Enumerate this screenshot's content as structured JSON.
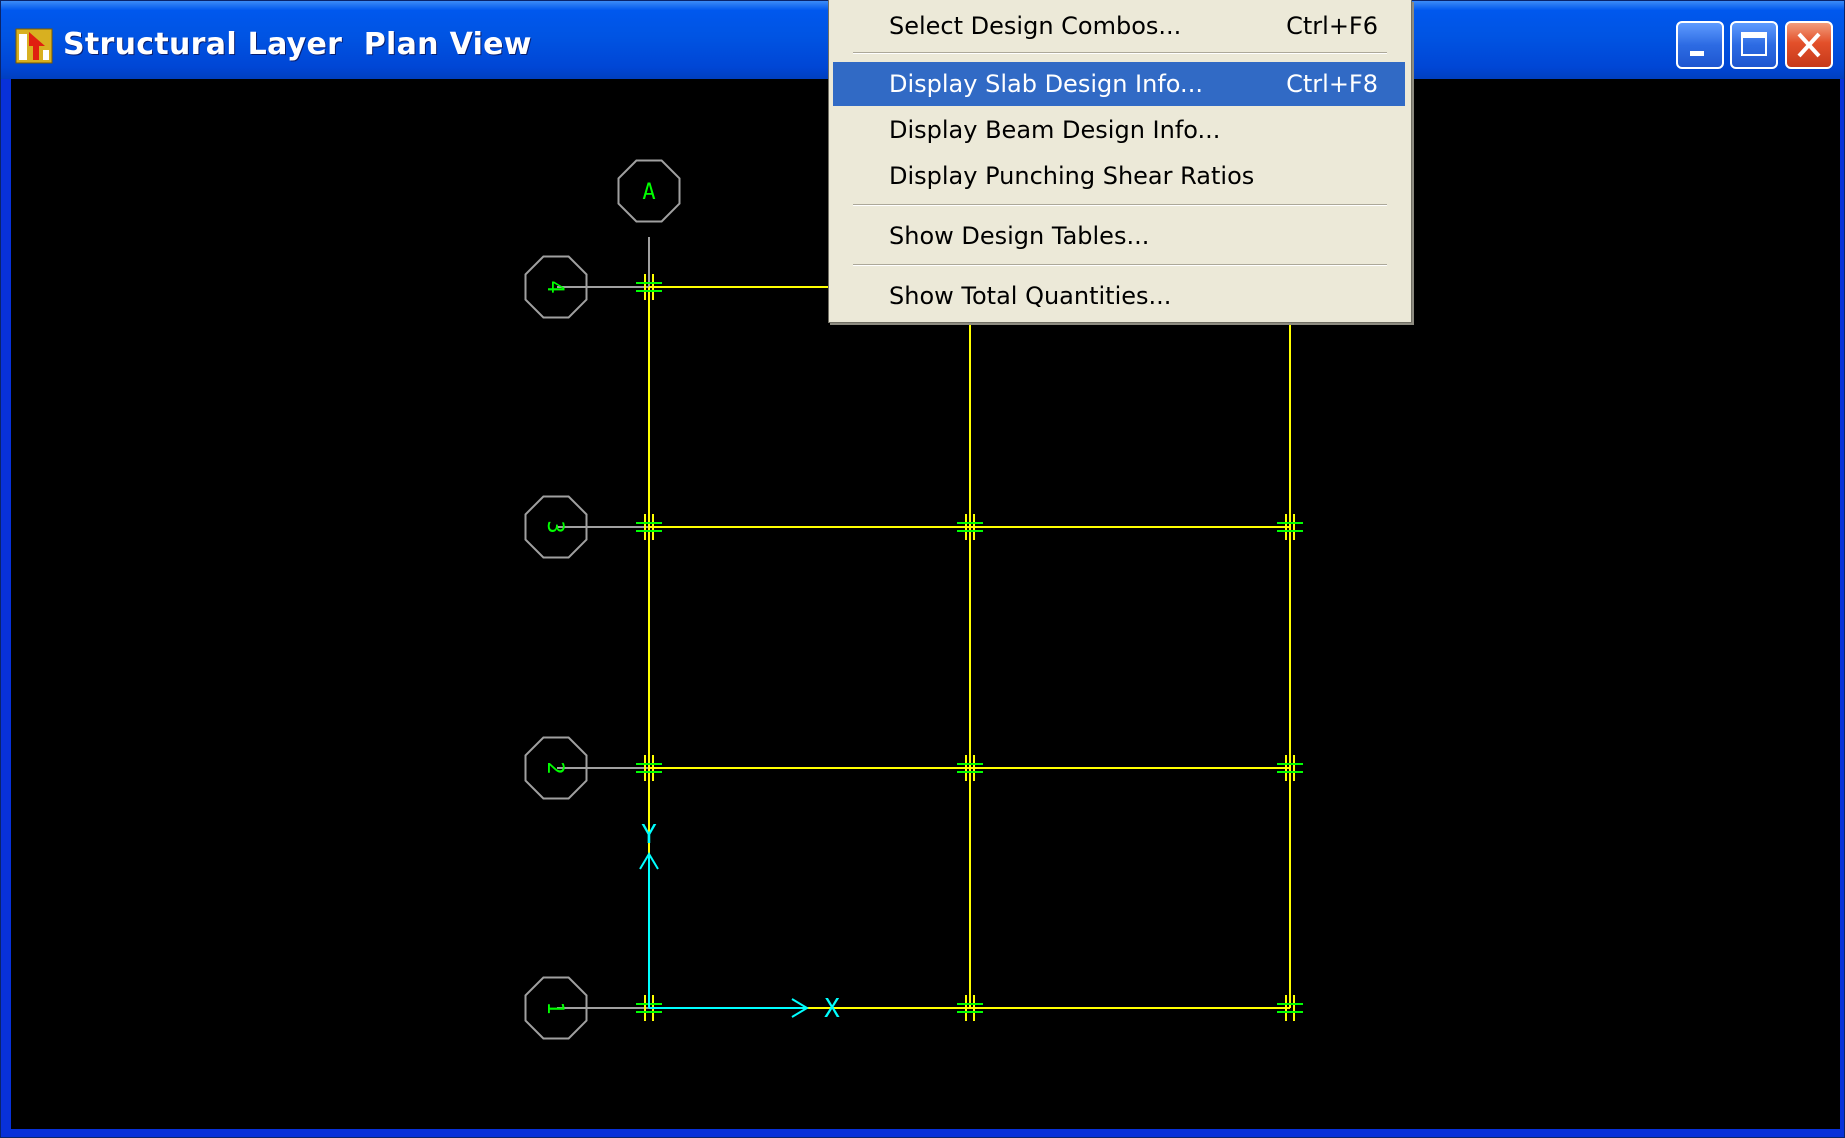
{
  "window": {
    "title": "Structural Layer  Plan View"
  },
  "title_buttons": {
    "minimize": "minimize-icon",
    "maximize": "maximize-icon",
    "close": "close-icon"
  },
  "plan": {
    "column_gridlines": [
      "A"
    ],
    "row_gridlines": [
      "4",
      "3",
      "2",
      "1"
    ],
    "axis_x_label": "X",
    "axis_y_label": "Y",
    "colors": {
      "beam": "#ffff00",
      "gridline_bubble": "#00ff00",
      "axis": "#00ffff",
      "background": "#000000"
    }
  },
  "context_menu": {
    "items": [
      {
        "label": "Select Design Combos...",
        "shortcut": "Ctrl+F6",
        "highlighted": false
      },
      {
        "label": "Display Slab Design Info...",
        "shortcut": "Ctrl+F8",
        "highlighted": true
      },
      {
        "label": "Display Beam Design Info...",
        "shortcut": "",
        "highlighted": false
      },
      {
        "label": "Display Punching Shear Ratios",
        "shortcut": "",
        "highlighted": false
      },
      {
        "label": "Show Design Tables...",
        "shortcut": "",
        "highlighted": false
      },
      {
        "label": "Show Total Quantities...",
        "shortcut": "",
        "highlighted": false
      }
    ]
  }
}
